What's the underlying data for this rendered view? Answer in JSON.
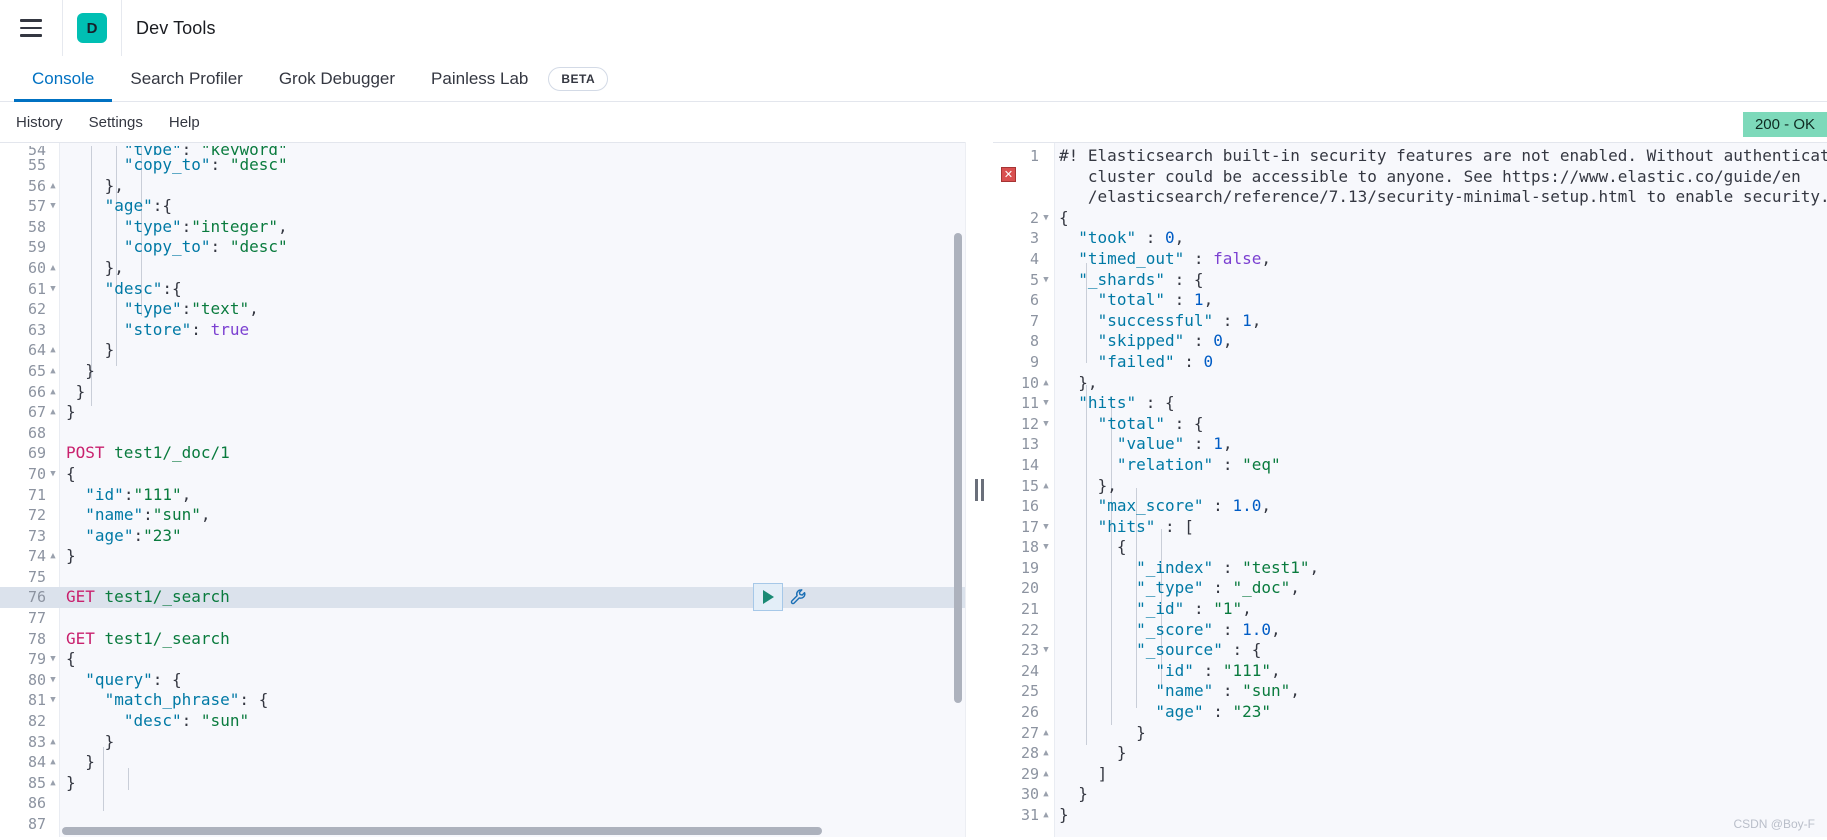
{
  "header": {
    "menu_icon": "hamburger-menu-icon",
    "logo_letter": "D",
    "title": "Dev Tools",
    "brand_color": "#00bfb3"
  },
  "tabs": [
    {
      "label": "Console",
      "active": true
    },
    {
      "label": "Search Profiler",
      "active": false
    },
    {
      "label": "Grok Debugger",
      "active": false
    },
    {
      "label": "Painless Lab",
      "active": false
    }
  ],
  "beta_badge": "BETA",
  "submenu": [
    {
      "label": "History"
    },
    {
      "label": "Settings"
    },
    {
      "label": "Help"
    }
  ],
  "status": {
    "label": "200 - OK",
    "bg": "#7dd9ba"
  },
  "watermark": "CSDN @Boy-F",
  "editor": {
    "actions": {
      "play": "play-button",
      "wrench": "wrench-button"
    },
    "lines": [
      {
        "n": "54",
        "fold": "",
        "text": "      \"type\": \"keyword\"",
        "clipped": true
      },
      {
        "n": "55",
        "fold": "",
        "text": "      \"copy_to\": \"desc\""
      },
      {
        "n": "56",
        "fold": "▲",
        "text": "    },"
      },
      {
        "n": "57",
        "fold": "▼",
        "text": "    \"age\":{"
      },
      {
        "n": "58",
        "fold": "",
        "text": "      \"type\":\"integer\","
      },
      {
        "n": "59",
        "fold": "",
        "text": "      \"copy_to\": \"desc\""
      },
      {
        "n": "60",
        "fold": "▲",
        "text": "    },"
      },
      {
        "n": "61",
        "fold": "▼",
        "text": "    \"desc\":{"
      },
      {
        "n": "62",
        "fold": "",
        "text": "      \"type\":\"text\","
      },
      {
        "n": "63",
        "fold": "",
        "text": "      \"store\": true"
      },
      {
        "n": "64",
        "fold": "▲",
        "text": "    }"
      },
      {
        "n": "65",
        "fold": "▲",
        "text": "  }"
      },
      {
        "n": "66",
        "fold": "▲",
        "text": " }"
      },
      {
        "n": "67",
        "fold": "▲",
        "text": "}"
      },
      {
        "n": "68",
        "fold": "",
        "text": ""
      },
      {
        "n": "69",
        "fold": "",
        "text": "POST test1/_doc/1"
      },
      {
        "n": "70",
        "fold": "▼",
        "text": "{"
      },
      {
        "n": "71",
        "fold": "",
        "text": "  \"id\":\"111\","
      },
      {
        "n": "72",
        "fold": "",
        "text": "  \"name\":\"sun\","
      },
      {
        "n": "73",
        "fold": "",
        "text": "  \"age\":\"23\""
      },
      {
        "n": "74",
        "fold": "▲",
        "text": "}"
      },
      {
        "n": "75",
        "fold": "",
        "text": ""
      },
      {
        "n": "76",
        "fold": "",
        "text": "GET test1/_search",
        "highlight": true,
        "cursor": true
      },
      {
        "n": "77",
        "fold": "",
        "text": ""
      },
      {
        "n": "78",
        "fold": "",
        "text": "GET test1/_search"
      },
      {
        "n": "79",
        "fold": "▼",
        "text": "{"
      },
      {
        "n": "80",
        "fold": "▼",
        "text": "  \"query\": {"
      },
      {
        "n": "81",
        "fold": "▼",
        "text": "    \"match_phrase\": {"
      },
      {
        "n": "82",
        "fold": "",
        "text": "      \"desc\": \"sun\""
      },
      {
        "n": "83",
        "fold": "▲",
        "text": "    }"
      },
      {
        "n": "84",
        "fold": "▲",
        "text": "  }"
      },
      {
        "n": "85",
        "fold": "▲",
        "text": "}"
      },
      {
        "n": "86",
        "fold": "",
        "text": ""
      },
      {
        "n": "87",
        "fold": "",
        "text": ""
      }
    ]
  },
  "response": {
    "error_marker": "error-marker-icon",
    "lines": [
      {
        "n": "1",
        "fold": "",
        "text": "#! Elasticsearch built-in security features are not enabled. Without authentication"
      },
      {
        "n": "",
        "fold": "",
        "text": "   cluster could be accessible to anyone. See https://www.elastic.co/guide/en"
      },
      {
        "n": "",
        "fold": "",
        "text": "   /elasticsearch/reference/7.13/security-minimal-setup.html to enable security."
      },
      {
        "n": "2",
        "fold": "▼",
        "text": "{"
      },
      {
        "n": "3",
        "fold": "",
        "text": "  \"took\" : 0,"
      },
      {
        "n": "4",
        "fold": "",
        "text": "  \"timed_out\" : false,"
      },
      {
        "n": "5",
        "fold": "▼",
        "text": "  \"_shards\" : {"
      },
      {
        "n": "6",
        "fold": "",
        "text": "    \"total\" : 1,"
      },
      {
        "n": "7",
        "fold": "",
        "text": "    \"successful\" : 1,"
      },
      {
        "n": "8",
        "fold": "",
        "text": "    \"skipped\" : 0,"
      },
      {
        "n": "9",
        "fold": "",
        "text": "    \"failed\" : 0"
      },
      {
        "n": "10",
        "fold": "▲",
        "text": "  },"
      },
      {
        "n": "11",
        "fold": "▼",
        "text": "  \"hits\" : {"
      },
      {
        "n": "12",
        "fold": "▼",
        "text": "    \"total\" : {"
      },
      {
        "n": "13",
        "fold": "",
        "text": "      \"value\" : 1,"
      },
      {
        "n": "14",
        "fold": "",
        "text": "      \"relation\" : \"eq\""
      },
      {
        "n": "15",
        "fold": "▲",
        "text": "    },"
      },
      {
        "n": "16",
        "fold": "",
        "text": "    \"max_score\" : 1.0,"
      },
      {
        "n": "17",
        "fold": "▼",
        "text": "    \"hits\" : ["
      },
      {
        "n": "18",
        "fold": "▼",
        "text": "      {"
      },
      {
        "n": "19",
        "fold": "",
        "text": "        \"_index\" : \"test1\","
      },
      {
        "n": "20",
        "fold": "",
        "text": "        \"_type\" : \"_doc\","
      },
      {
        "n": "21",
        "fold": "",
        "text": "        \"_id\" : \"1\","
      },
      {
        "n": "22",
        "fold": "",
        "text": "        \"_score\" : 1.0,"
      },
      {
        "n": "23",
        "fold": "▼",
        "text": "        \"_source\" : {"
      },
      {
        "n": "24",
        "fold": "",
        "text": "          \"id\" : \"111\","
      },
      {
        "n": "25",
        "fold": "",
        "text": "          \"name\" : \"sun\","
      },
      {
        "n": "26",
        "fold": "",
        "text": "          \"age\" : \"23\""
      },
      {
        "n": "27",
        "fold": "▲",
        "text": "        }"
      },
      {
        "n": "28",
        "fold": "▲",
        "text": "      }"
      },
      {
        "n": "29",
        "fold": "▲",
        "text": "    ]"
      },
      {
        "n": "30",
        "fold": "▲",
        "text": "  }"
      },
      {
        "n": "31",
        "fold": "▲",
        "text": "}"
      }
    ]
  }
}
